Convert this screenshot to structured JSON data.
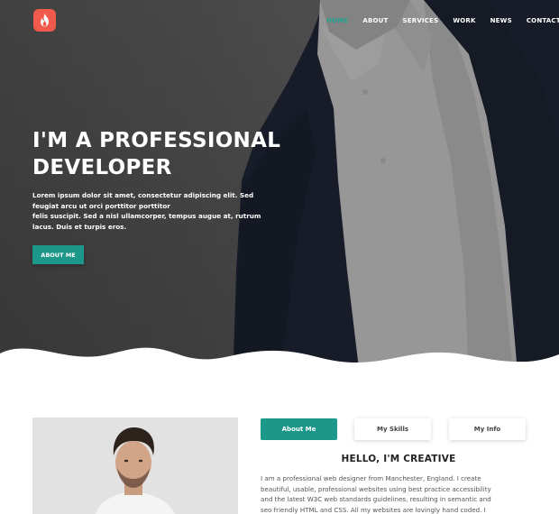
{
  "header": {
    "logo_icon": "flame-icon",
    "nav": [
      {
        "label": "HOME",
        "active": true
      },
      {
        "label": "ABOUT",
        "active": false
      },
      {
        "label": "SERVICES",
        "active": false
      },
      {
        "label": "WORK",
        "active": false
      },
      {
        "label": "NEWS",
        "active": false
      },
      {
        "label": "CONTACT",
        "active": false
      }
    ]
  },
  "hero": {
    "title_line1": "I'M A PROFESSIONAL",
    "title_line2": "DEVELOPER",
    "description_line1": "Lorem ipsum dolor sit amet, consectetur adipiscing elit. Sed",
    "description_line2": "feugiat arcu ut orci porttitor porttitor",
    "description_line3": "felis suscipit. Sed a nisl ullamcorper, tempus augue at, rutrum",
    "description_line4": "lacus. Duis et turpis eros.",
    "button_label": "ABOUT ME"
  },
  "about": {
    "tabs": [
      {
        "label": "About Me",
        "active": true
      },
      {
        "label": "My Skills",
        "active": false
      },
      {
        "label": "My Info",
        "active": false
      }
    ],
    "heading": "HELLO, I'M CREATIVE",
    "text_line1": "I am a professional web designer from Manchester, England. I create",
    "text_line2": "beautiful, usable, professional websites using best practice accessibility",
    "text_line3": "and the latest W3C web standards guidelines, resulting in semantic and",
    "text_line4": "seo friendly HTML and CSS. All my websites are lovingly hand coded. I"
  },
  "colors": {
    "accent": "#1c978a",
    "logo": "#ef5a4c",
    "hero_overlay": "#5f5f5f",
    "suit": "#1e2437"
  }
}
